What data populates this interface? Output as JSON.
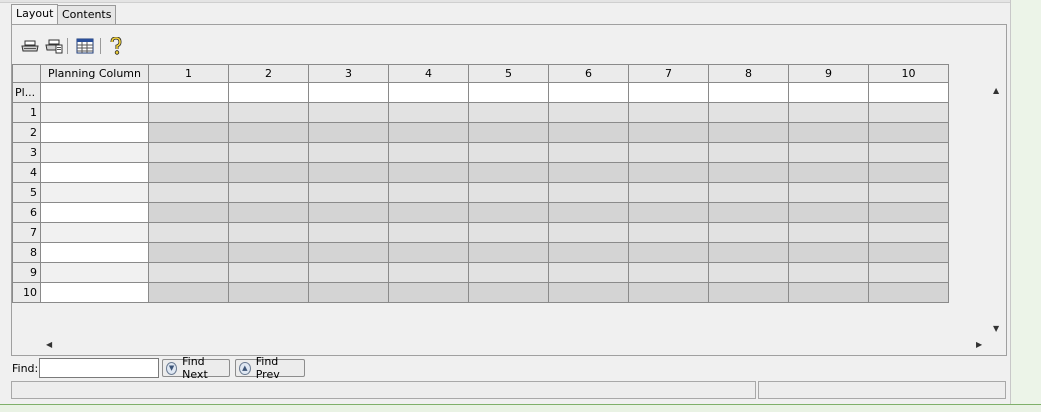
{
  "tabs": [
    {
      "label": "Layout",
      "active": true
    },
    {
      "label": "Contents",
      "active": false
    }
  ],
  "toolbar": {
    "icons": [
      "print-icon",
      "print-preview-icon",
      "table-settings-icon",
      "help-icon"
    ]
  },
  "grid": {
    "corner": "",
    "planning_header": "Planning Column",
    "columns": [
      "1",
      "2",
      "3",
      "4",
      "5",
      "6",
      "7",
      "8",
      "9",
      "10"
    ],
    "planning_row_label": "Pl...",
    "rows": [
      "1",
      "2",
      "3",
      "4",
      "5",
      "6",
      "7",
      "8",
      "9",
      "10"
    ]
  },
  "find": {
    "label": "Find:",
    "value": "",
    "next_label": "Find Next",
    "prev_label": "Find Prev"
  },
  "colors": {
    "cell_light": "#e2e2e2",
    "cell_dark": "#d4d4d4",
    "header_bg": "#ebebeb",
    "accent_green": "#7fb06a"
  }
}
